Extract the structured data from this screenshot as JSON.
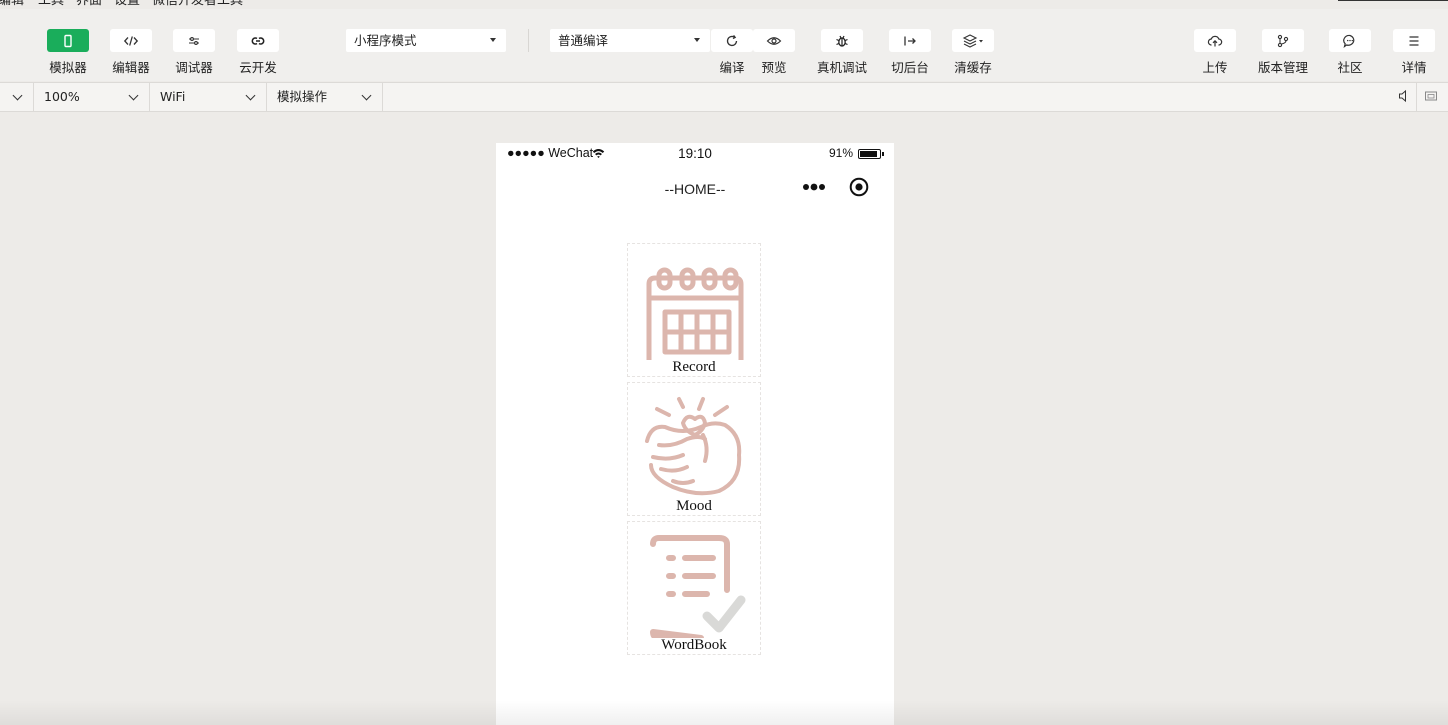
{
  "menu": {
    "items": [
      "编辑",
      "工具",
      "界面",
      "设置",
      "微信开发者工具"
    ]
  },
  "toolbar": {
    "left_tools": [
      {
        "label": "模拟器",
        "icon": "phone-icon",
        "active": true
      },
      {
        "label": "编辑器",
        "icon": "code-icon",
        "active": false
      },
      {
        "label": "调试器",
        "icon": "debug-sliders-icon",
        "active": false
      },
      {
        "label": "云开发",
        "icon": "cloud-link-icon",
        "active": false
      }
    ],
    "mode_select": "小程序模式",
    "compile_select": "普通编译",
    "middle_tools": [
      {
        "label": "编译",
        "icon": "refresh-icon"
      },
      {
        "label": "预览",
        "icon": "eye-icon"
      },
      {
        "label": "真机调试",
        "icon": "bug-icon"
      },
      {
        "label": "切后台",
        "icon": "switch-background-icon"
      },
      {
        "label": "清缓存",
        "icon": "layers-icon"
      }
    ],
    "right_tools": [
      {
        "label": "上传",
        "icon": "cloud-upload-icon"
      },
      {
        "label": "版本管理",
        "icon": "branch-icon"
      },
      {
        "label": "社区",
        "icon": "chat-bubble-icon"
      },
      {
        "label": "详情",
        "icon": "menu-lines-icon"
      }
    ]
  },
  "subbar": {
    "zoom": "100%",
    "network": "WiFi",
    "operation": "模拟操作"
  },
  "phone": {
    "carrier": "●●●●● WeChat",
    "time": "19:10",
    "battery": "91%",
    "battery_level": 0.91,
    "nav_title": "--HOME--",
    "tiles": [
      {
        "label": "Record",
        "icon": "calendar-icon"
      },
      {
        "label": "Mood",
        "icon": "finger-heart-icon"
      },
      {
        "label": "WordBook",
        "icon": "checklist-icon"
      }
    ],
    "icon_color": "#dcb6ad"
  },
  "colors": {
    "accent": "#1aad5b"
  }
}
